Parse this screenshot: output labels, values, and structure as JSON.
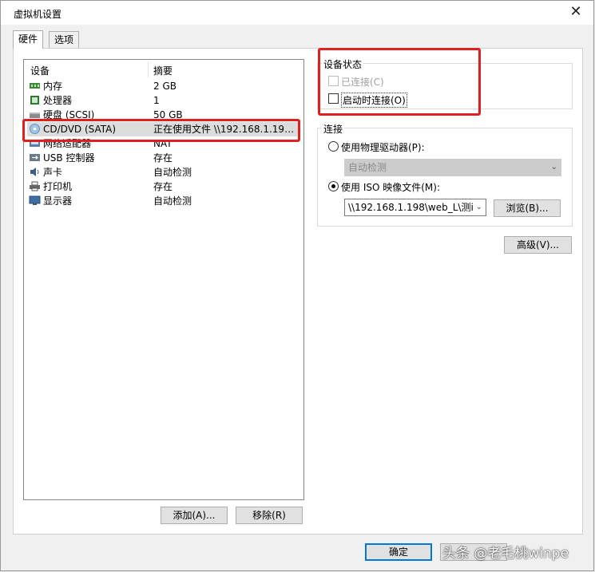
{
  "window": {
    "title": "虚拟机设置",
    "close_glyph": "✕"
  },
  "tabs": [
    {
      "label": "硬件"
    },
    {
      "label": "选项"
    }
  ],
  "device_list": {
    "headers": {
      "device": "设备",
      "summary": "摘要"
    },
    "rows": [
      {
        "name": "内存",
        "summary": "2 GB",
        "icon": "memory-icon"
      },
      {
        "name": "处理器",
        "summary": "1",
        "icon": "processor-icon"
      },
      {
        "name": "硬盘 (SCSI)",
        "summary": "50 GB",
        "icon": "harddisk-icon"
      },
      {
        "name": "CD/DVD (SATA)",
        "summary": "正在使用文件 \\\\192.168.1.198...",
        "icon": "cd-dvd-icon",
        "selected": true
      },
      {
        "name": "网络适配器",
        "summary": "NAT",
        "icon": "network-adapter-icon"
      },
      {
        "name": "USB 控制器",
        "summary": "存在",
        "icon": "usb-icon"
      },
      {
        "name": "声卡",
        "summary": "自动检测",
        "icon": "sound-icon"
      },
      {
        "name": "打印机",
        "summary": "存在",
        "icon": "printer-icon"
      },
      {
        "name": "显示器",
        "summary": "自动检测",
        "icon": "display-icon"
      }
    ]
  },
  "buttons": {
    "add": "添加(A)...",
    "remove": "移除(R)",
    "ok": "确定",
    "browse": "浏览(B)...",
    "advanced": "高级(V)..."
  },
  "device_status": {
    "label": "设备状态",
    "connected": {
      "label": "已连接(C)",
      "checked": false,
      "disabled": true
    },
    "connect_at_power_on": {
      "label": "启动时连接(O)",
      "checked": false
    }
  },
  "connection": {
    "label": "连接",
    "physical_drive": {
      "label": "使用物理驱动器(P):",
      "selected": false,
      "value": "自动检测"
    },
    "iso_image": {
      "label": "使用 ISO 映像文件(M):",
      "selected": true,
      "value": "\\\\192.168.1.198\\web_L\\测i"
    }
  },
  "watermark": "头条 @老毛桃winpe",
  "colors": {
    "highlight": "#e02020",
    "accent": "#0078d7"
  }
}
